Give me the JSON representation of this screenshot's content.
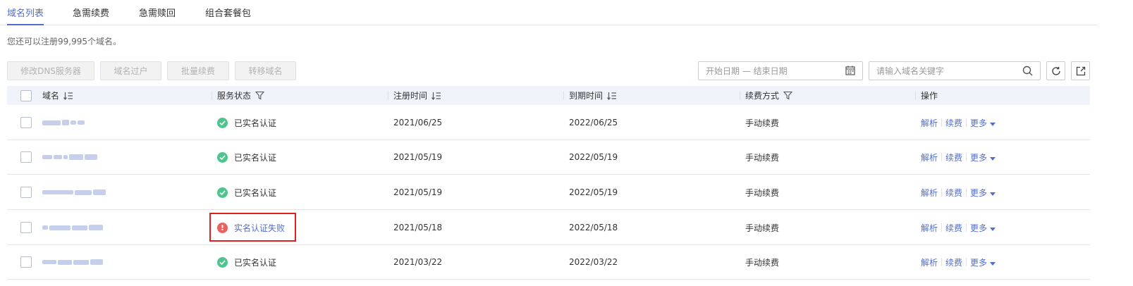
{
  "tabs": [
    {
      "label": "域名列表",
      "active": true
    },
    {
      "label": "急需续费"
    },
    {
      "label": "急需赎回"
    },
    {
      "label": "组合套餐包"
    }
  ],
  "quota_text": "您还可以注册99,995个域名。",
  "toolbar": {
    "modify_dns": "修改DNS服务器",
    "transfer_owner": "域名过户",
    "batch_renew": "批量续费",
    "transfer_domain": "转移域名",
    "date_placeholder": "开始日期 — 结束日期",
    "search_placeholder": "请输入域名关键字"
  },
  "columns": {
    "domain": "域名",
    "status": "服务状态",
    "reg_time": "注册时间",
    "exp_time": "到期时间",
    "renew_mode": "续费方式",
    "ops": "操作"
  },
  "rows": [
    {
      "status": "已实名认证",
      "status_type": "ok",
      "reg": "2021/06/25",
      "exp": "2022/06/25",
      "renew": "手动续费"
    },
    {
      "status": "已实名认证",
      "status_type": "ok",
      "reg": "2021/05/19",
      "exp": "2022/05/19",
      "renew": "手动续费"
    },
    {
      "status": "已实名认证",
      "status_type": "ok",
      "reg": "2021/05/19",
      "exp": "2022/05/19",
      "renew": "手动续费"
    },
    {
      "status": "实名认证失败",
      "status_type": "error",
      "reg": "2021/05/18",
      "exp": "2022/05/18",
      "renew": "手动续费"
    },
    {
      "status": "已实名认证",
      "status_type": "ok",
      "reg": "2021/03/22",
      "exp": "2022/03/22",
      "renew": "手动续费"
    }
  ],
  "ops": {
    "resolve": "解析",
    "renew": "续费",
    "more": "更多"
  },
  "colors": {
    "accent": "#526ecc",
    "ok": "#50c48f",
    "error": "#ee6060",
    "highlight": "#e02020"
  }
}
